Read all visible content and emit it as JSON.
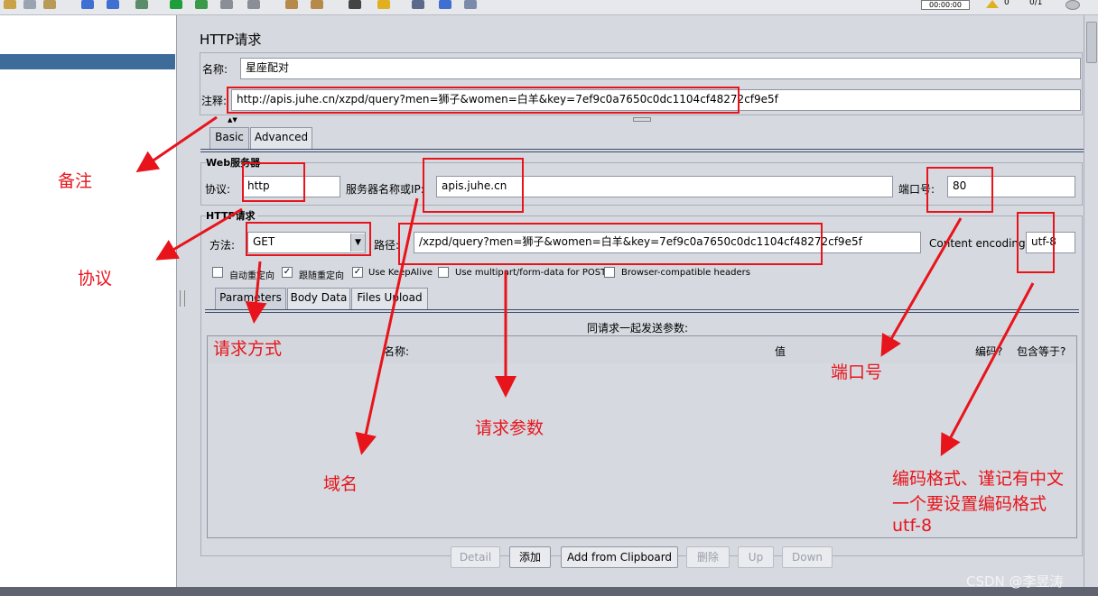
{
  "toolbar": {
    "timer": "00:00:00",
    "warn_count": "0",
    "thread_count": "0/1"
  },
  "panel": {
    "title": "HTTP请求",
    "name_label": "名称:",
    "name_value": "星座配对",
    "comment_label": "注释:",
    "comment_value": "http://apis.juhe.cn/xzpd/query?men=狮子&women=白羊&key=7ef9c0a7650c0dc1104cf48272cf9e5f",
    "tabs": [
      "Basic",
      "Advanced"
    ],
    "web_server": {
      "section_title": "Web服务器",
      "protocol_label": "协议:",
      "protocol_value": "http",
      "server_label": "服务器名称或IP:",
      "server_value": "apis.juhe.cn",
      "port_label": "端口号:",
      "port_value": "80"
    },
    "http_request": {
      "section_title": "HTTP请求",
      "method_label": "方法:",
      "method_value": "GET",
      "path_label": "路径:",
      "path_value": "/xzpd/query?men=狮子&women=白羊&key=7ef9c0a7650c0dc1104cf48272cf9e5f",
      "encoding_label": "Content encoding:",
      "encoding_value": "utf-8"
    },
    "options": [
      {
        "label": "自动重定向",
        "checked": false
      },
      {
        "label": "跟随重定向",
        "checked": true
      },
      {
        "label": "Use KeepAlive",
        "checked": true
      },
      {
        "label": "Use multipart/form-data for POST",
        "checked": false
      },
      {
        "label": "Browser-compatible headers",
        "checked": false
      }
    ],
    "sub_tabs": [
      "Parameters",
      "Body Data",
      "Files Upload"
    ],
    "params": {
      "caption": "同请求一起发送参数:",
      "columns": [
        "名称:",
        "值",
        "编码?",
        "包含等于?"
      ]
    },
    "buttons": {
      "detail": "Detail",
      "add": "添加",
      "add_clipboard": "Add from Clipboard",
      "delete": "删除",
      "up": "Up",
      "down": "Down"
    }
  },
  "annotations": {
    "comment": "备注",
    "protocol": "协议",
    "method": "请求方式",
    "domain": "域名",
    "params": "请求参数",
    "port": "端口号",
    "encoding_line1": "编码格式、谨记有中文",
    "encoding_line2": "一个要设置编码格式",
    "encoding_line3": "utf-8"
  },
  "watermark": "CSDN @李昱涛",
  "colors": {
    "annotation_red": "#e8141c",
    "selection": "#3d6b9a"
  }
}
